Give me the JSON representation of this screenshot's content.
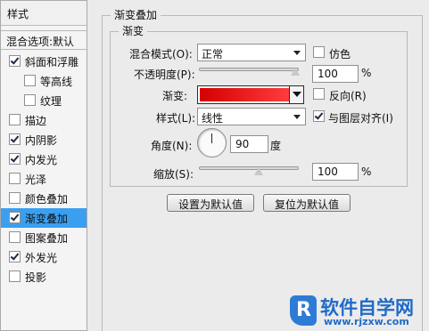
{
  "style_list": {
    "header": "样式",
    "blend_options": "混合选项:默认",
    "items": [
      {
        "label": "斜面和浮雕",
        "checked": true,
        "sub": false,
        "selected": false
      },
      {
        "label": "等高线",
        "checked": false,
        "sub": true,
        "selected": false
      },
      {
        "label": "纹理",
        "checked": false,
        "sub": true,
        "selected": false
      },
      {
        "label": "描边",
        "checked": false,
        "sub": false,
        "selected": false
      },
      {
        "label": "内阴影",
        "checked": true,
        "sub": false,
        "selected": false
      },
      {
        "label": "内发光",
        "checked": true,
        "sub": false,
        "selected": false
      },
      {
        "label": "光泽",
        "checked": false,
        "sub": false,
        "selected": false
      },
      {
        "label": "颜色叠加",
        "checked": false,
        "sub": false,
        "selected": false
      },
      {
        "label": "渐变叠加",
        "checked": true,
        "sub": false,
        "selected": true
      },
      {
        "label": "图案叠加",
        "checked": false,
        "sub": false,
        "selected": false
      },
      {
        "label": "外发光",
        "checked": true,
        "sub": false,
        "selected": false
      },
      {
        "label": "投影",
        "checked": false,
        "sub": false,
        "selected": false
      }
    ]
  },
  "panel": {
    "group_title": "渐变叠加",
    "subgroup_title": "渐变",
    "blend_mode_label": "混合模式(O):",
    "blend_mode_value": "正常",
    "dither_label": "仿色",
    "dither_checked": false,
    "opacity_label": "不透明度(P):",
    "opacity_value": "100",
    "opacity_unit": "%",
    "opacity_slider_percent": 100,
    "gradient_label": "渐变:",
    "gradient_colors": [
      "#d40000",
      "#ff3c3c"
    ],
    "reverse_label": "反向(R)",
    "reverse_checked": false,
    "style_label": "样式(L):",
    "style_value": "线性",
    "align_label": "与图层对齐(I)",
    "align_checked": true,
    "angle_label": "角度(N):",
    "angle_value": "90",
    "angle_unit": "度",
    "scale_label": "缩放(S):",
    "scale_value": "100",
    "scale_unit": "%",
    "scale_slider_percent": 100,
    "default_button": "设置为默认值",
    "reset_button": "复位为默认值"
  },
  "watermark": {
    "logo_letter": "R",
    "brand": "软件自学网",
    "url": "www.rjzxw.com"
  }
}
